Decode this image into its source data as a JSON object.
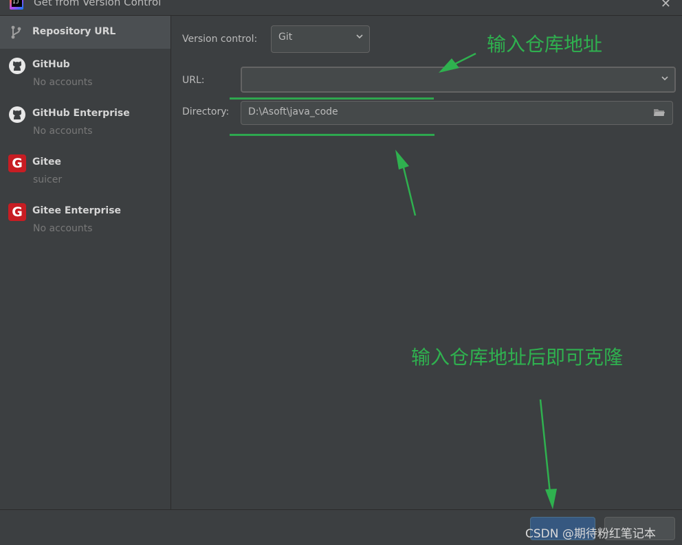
{
  "window": {
    "title": "Get from Version Control",
    "close_icon": "close-icon"
  },
  "sidebar": {
    "items": [
      {
        "title": "Repository URL",
        "subtitle": "",
        "icon": "git-branch-icon",
        "selected": true
      },
      {
        "title": "GitHub",
        "subtitle": "No accounts",
        "icon": "github-icon",
        "selected": false
      },
      {
        "title": "GitHub Enterprise",
        "subtitle": "No accounts",
        "icon": "github-icon",
        "selected": false
      },
      {
        "title": "Gitee",
        "subtitle": "suicer",
        "icon": "gitee-icon",
        "selected": false
      },
      {
        "title": "Gitee Enterprise",
        "subtitle": "No accounts",
        "icon": "gitee-icon",
        "selected": false
      }
    ]
  },
  "form": {
    "version_control_label": "Version control:",
    "version_control_value": "Git",
    "url_label": "URL:",
    "url_value": "",
    "directory_label": "Directory:",
    "directory_value": "D:\\Asoft\\java_code"
  },
  "annotations": {
    "top": "输入仓库地址",
    "bottom": "输入仓库地址后即可克隆",
    "color": "#2fb14f"
  },
  "buttons": {
    "clone_label": "",
    "cancel_label": ""
  },
  "watermark": "CSDN @期待粉红笔记本",
  "colors": {
    "background": "#3c3f41",
    "selected": "#4b4f52",
    "primary_button": "#365880",
    "annotation": "#2fb14f"
  }
}
